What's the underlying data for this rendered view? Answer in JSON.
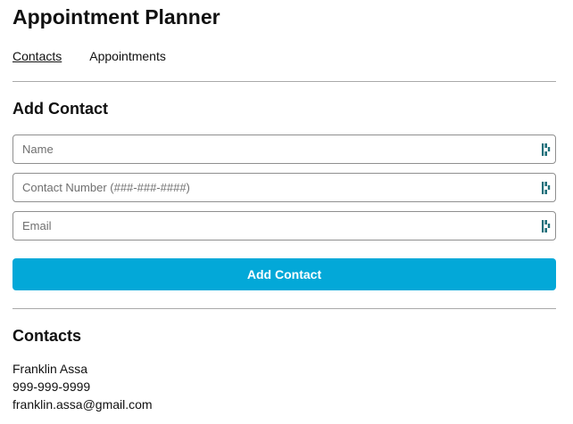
{
  "header": {
    "title": "Appointment Planner"
  },
  "nav": {
    "items": [
      {
        "label": "Contacts",
        "active": true
      },
      {
        "label": "Appointments",
        "active": false
      }
    ]
  },
  "add_contact": {
    "heading": "Add Contact",
    "fields": [
      {
        "name": "name",
        "placeholder": "Name",
        "value": "",
        "icon": "password-manager-key-icon"
      },
      {
        "name": "phone",
        "placeholder": "Contact Number (###-###-####)",
        "value": "",
        "icon": "password-manager-key-icon"
      },
      {
        "name": "email",
        "placeholder": "Email",
        "value": "",
        "icon": "password-manager-key-icon"
      }
    ],
    "submit_label": "Add Contact",
    "submit_color": "#03a8d8"
  },
  "contacts": {
    "heading": "Contacts",
    "items": [
      {
        "name": "Franklin Assa",
        "phone": "999-999-9999",
        "email": "franklin.assa@gmail.com"
      }
    ]
  },
  "colors": {
    "accent": "#03a8d8",
    "icon": "#1f6f7a",
    "divider": "#a9a9a9"
  }
}
